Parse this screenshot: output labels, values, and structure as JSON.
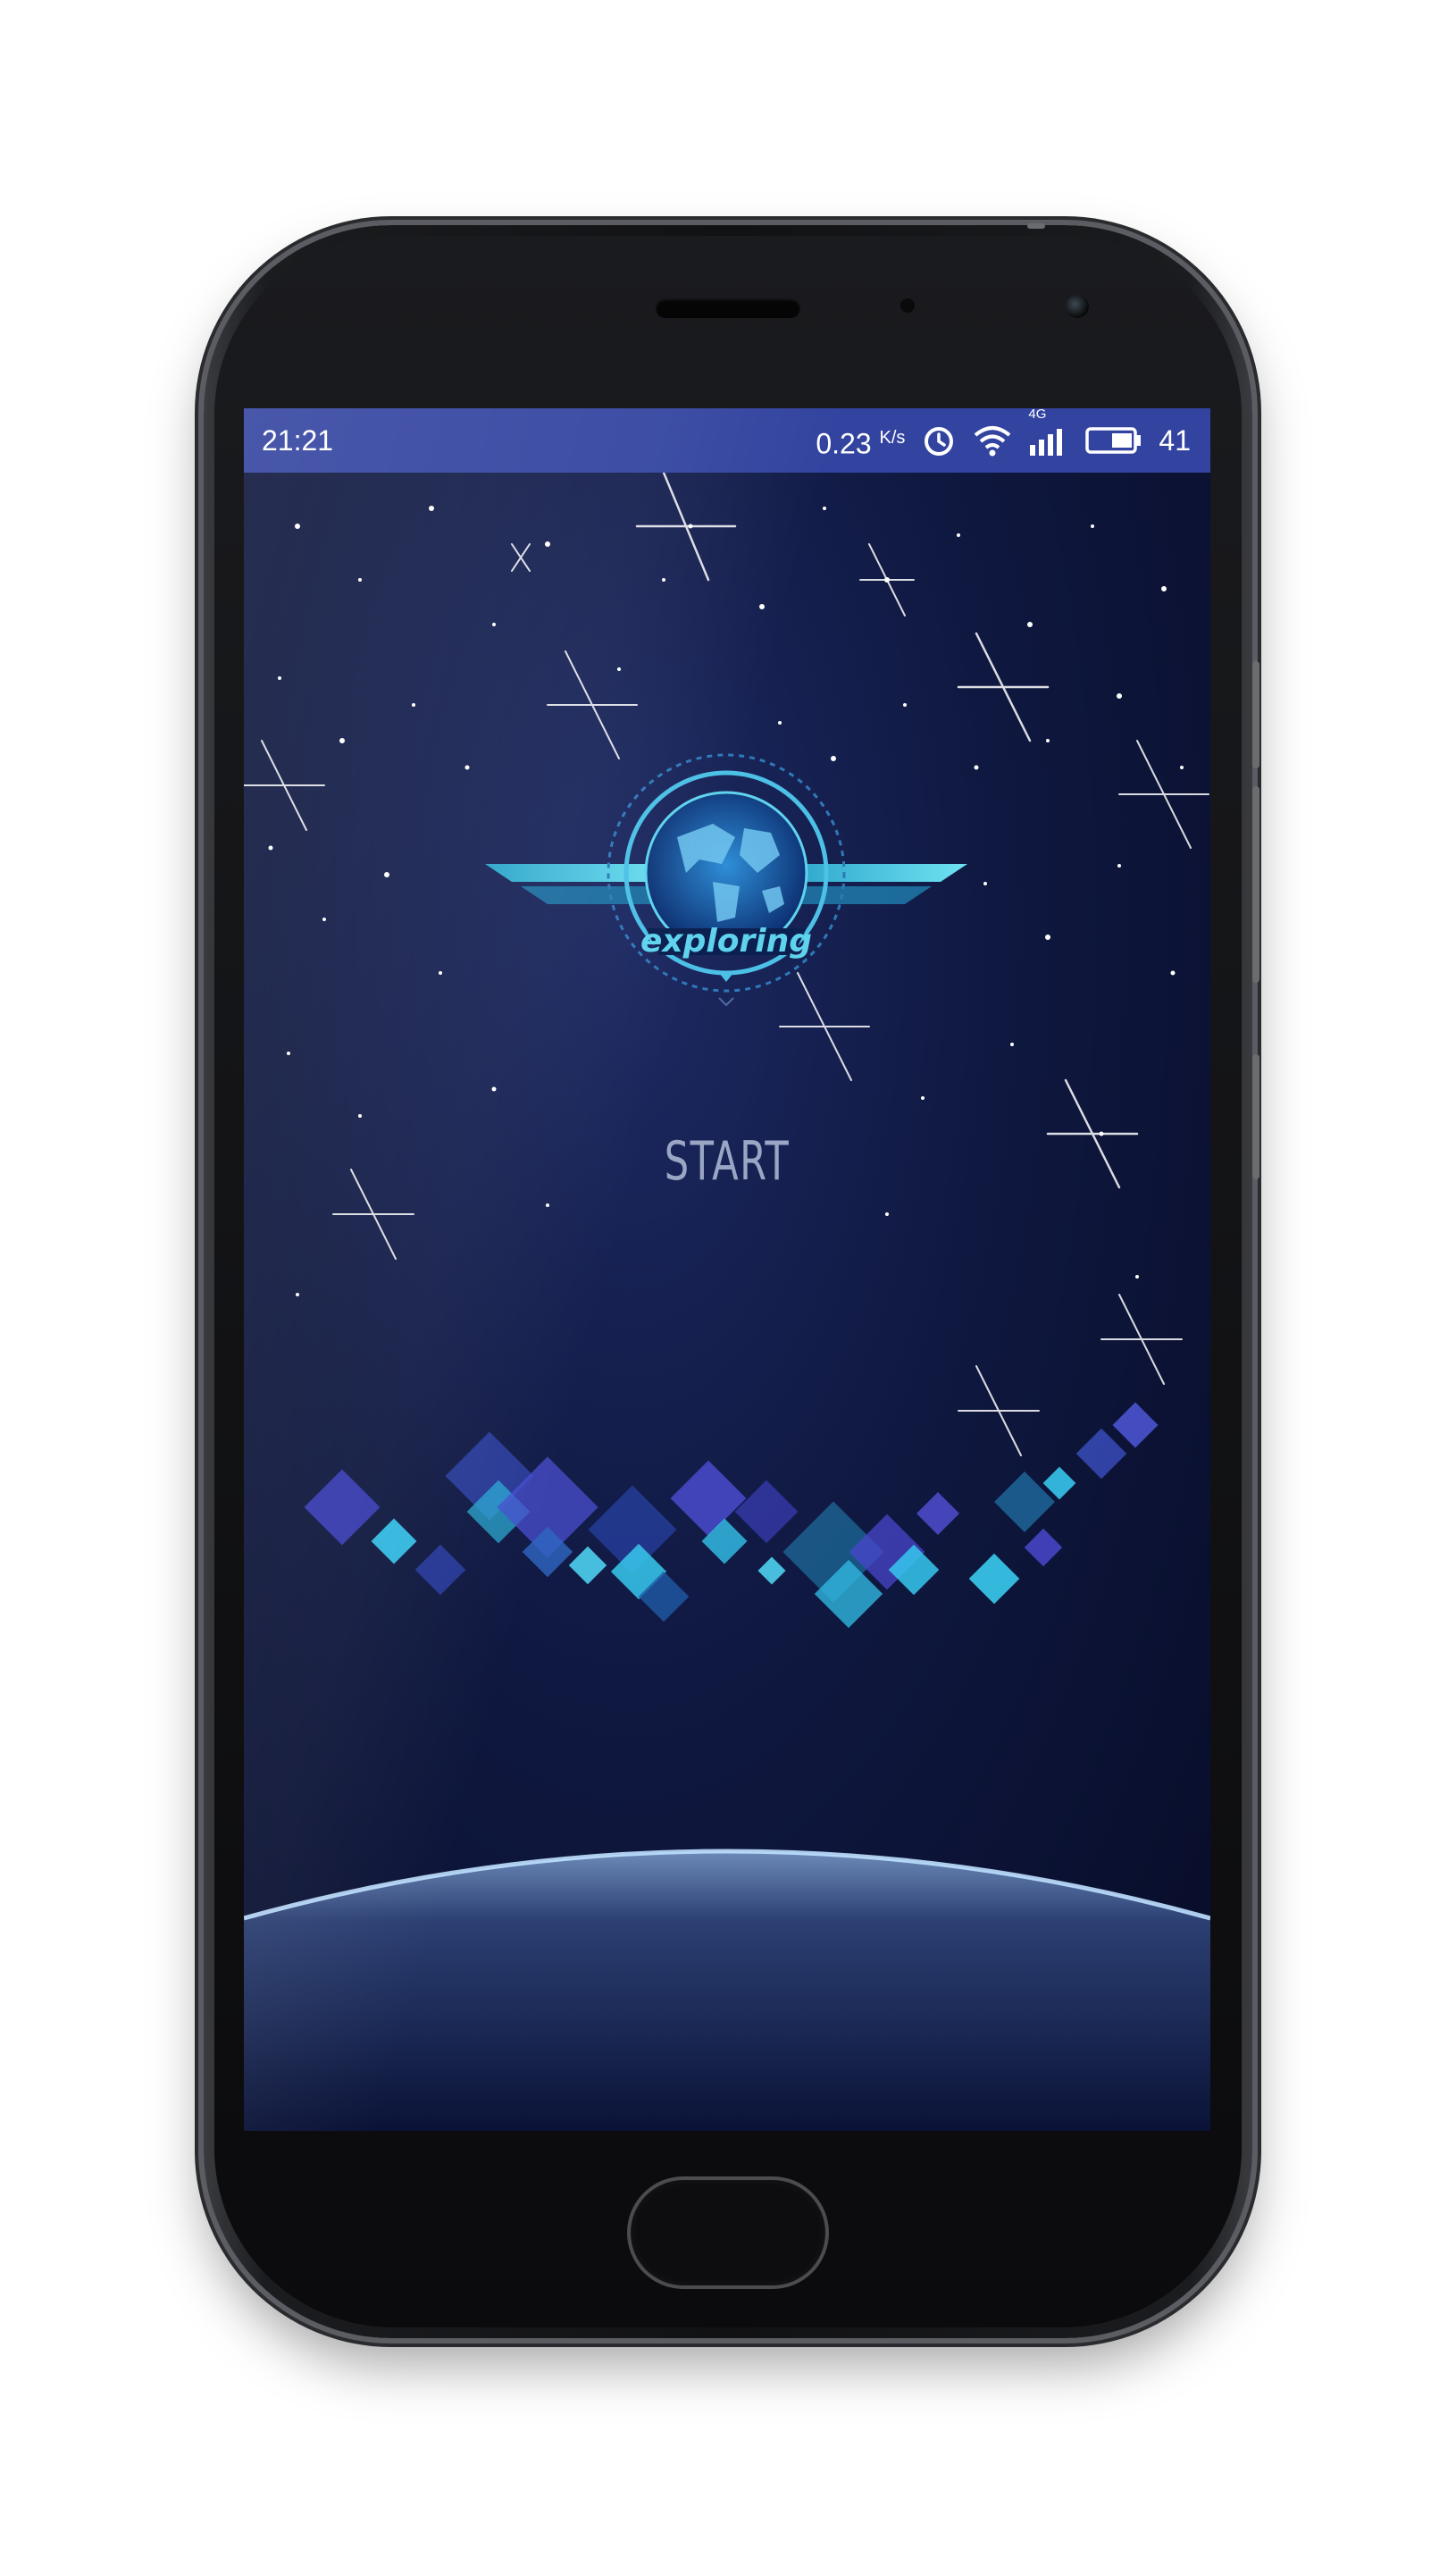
{
  "status_bar": {
    "time": "21:21",
    "net_speed": "0.23",
    "net_speed_unit": "K/s",
    "network_type": "4G",
    "battery_level": "41",
    "icons": [
      "alarm-icon",
      "wifi-icon",
      "signal-icon",
      "battery-icon"
    ]
  },
  "app": {
    "logo_text": "exploring",
    "start_label": "START"
  },
  "colors": {
    "status_bar_bg": "#3344a0",
    "space_bg": "#0f1840",
    "accent_cyan": "#4fd0e8",
    "start_text": "#9aa6c4"
  }
}
